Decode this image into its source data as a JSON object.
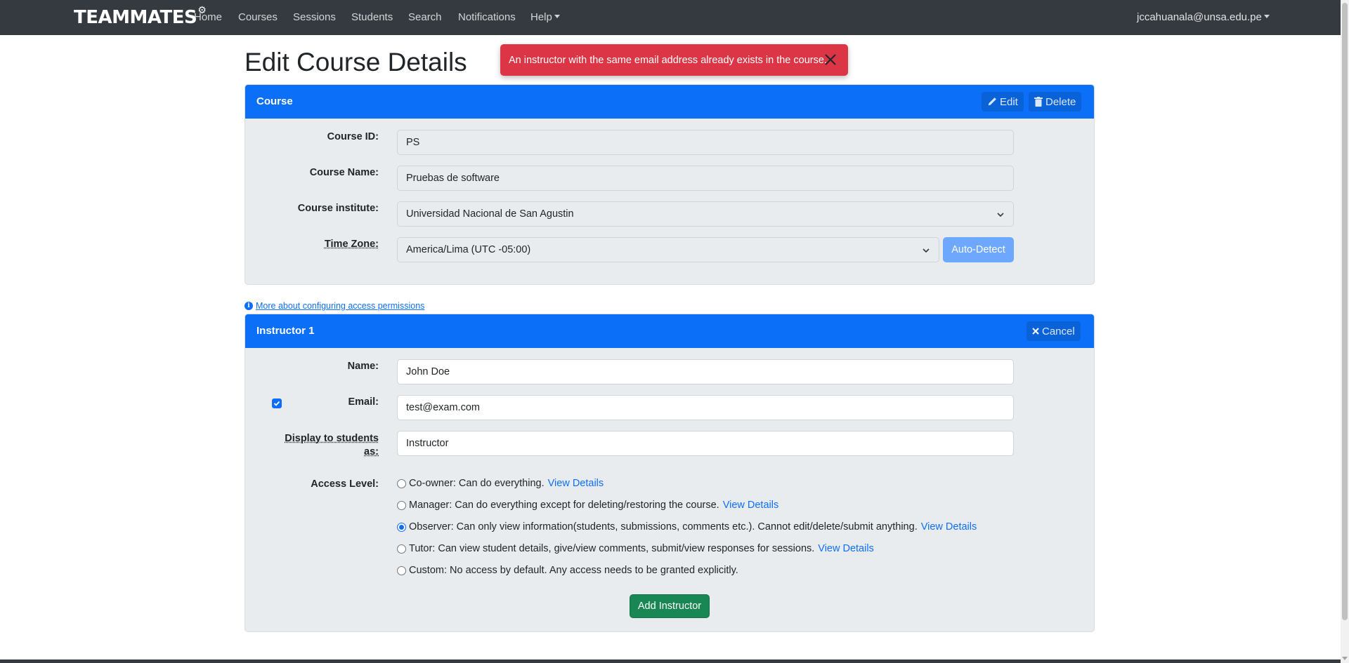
{
  "navbar": {
    "brand": "TEAMMATES",
    "items": [
      {
        "label": "Home"
      },
      {
        "label": "Courses"
      },
      {
        "label": "Sessions"
      },
      {
        "label": "Students"
      },
      {
        "label": "Search"
      },
      {
        "label": "Notifications"
      },
      {
        "label": "Help"
      }
    ],
    "user": "jccahuanala@unsa.edu.pe"
  },
  "page_title": "Edit Course Details",
  "toast": {
    "message": "An instructor with the same email address already exists in the course.",
    "color": "#dc3545"
  },
  "course_card": {
    "title": "Course",
    "edit_label": "Edit",
    "delete_label": "Delete",
    "fields": {
      "course_id_label": "Course ID:",
      "course_id_value": "PS",
      "course_name_label": "Course Name:",
      "course_name_value": "Pruebas de software",
      "institute_label": "Course institute:",
      "institute_value": "Universidad Nacional de San Agustin",
      "timezone_label": "Time Zone:",
      "timezone_value": "America/Lima (UTC -05:00)",
      "auto_detect_label": "Auto-Detect"
    }
  },
  "info_link": "More about configuring access permissions",
  "instructor_card": {
    "title": "Instructor 1",
    "cancel_label": "Cancel",
    "name_label": "Name:",
    "name_value": "John Doe",
    "email_label": "Email:",
    "email_value": "test@exam.com",
    "display_label_line1": "Display to students",
    "display_label_line2": "as:",
    "display_checked": true,
    "display_value": "Instructor",
    "access_label": "Access Level:",
    "access_options": [
      {
        "text": "Co-owner: Can do everything.",
        "link": "View Details",
        "checked": false
      },
      {
        "text": "Manager: Can do everything except for deleting/restoring the course.",
        "link": "View Details",
        "checked": false
      },
      {
        "text": "Observer: Can only view information(students, submissions, comments etc.). Cannot edit/delete/submit anything.",
        "link": "View Details",
        "checked": true
      },
      {
        "text": "Tutor: Can view student details, give/view comments, submit/view responses for sessions.",
        "link": "View Details",
        "checked": false
      },
      {
        "text": "Custom: No access by default. Any access needs to be granted explicitly.",
        "link": "",
        "checked": false
      }
    ],
    "add_button_label": "Add Instructor"
  },
  "colors": {
    "navbar": "#343a40",
    "card_header": "#0b6ff7",
    "primary": "#0d6efd",
    "success": "#198754",
    "danger": "#dc3545"
  }
}
